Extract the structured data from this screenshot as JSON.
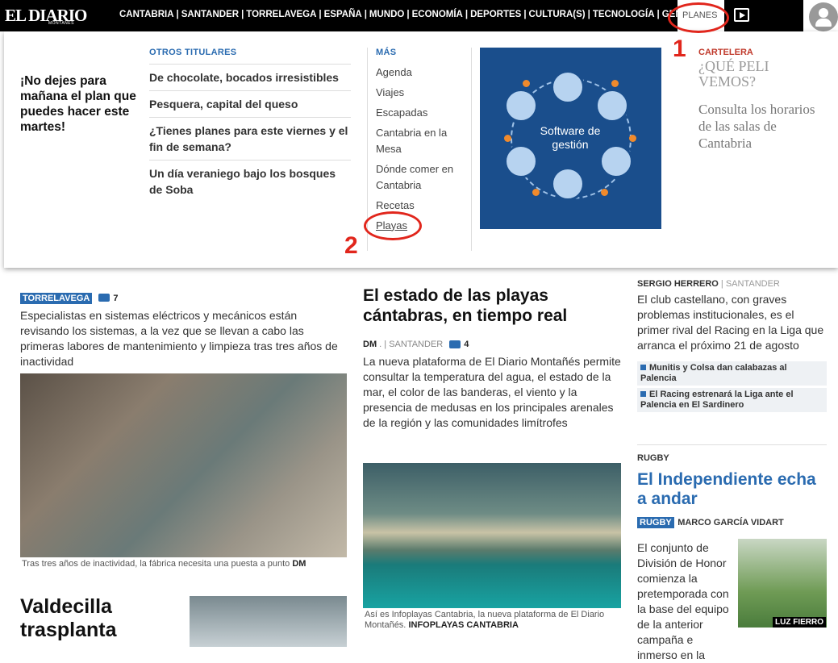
{
  "header": {
    "logo": "EL DIARIO",
    "logo_sub": "MONTAÑÉS",
    "nav": [
      "CANTABRIA",
      "SANTANDER",
      "TORRELAVEGA",
      "ESPAÑA",
      "MUNDO",
      "ECONOMÍA",
      "DEPORTES",
      "CULTURA(S)",
      "TECNOLOGÍA",
      "GENTE"
    ],
    "planes": "PLANES"
  },
  "dropdown": {
    "promo": "¡No dejes para mañana el plan que puedes hacer este martes!",
    "otros_title": "OTROS TITULARES",
    "otros": [
      "De chocolate, bocados irresistibles",
      "Pesquera, capital del queso",
      "¿Tienes planes para este viernes y el fin de semana?",
      "Un día veraniego bajo los bosques de Soba"
    ],
    "mas_title": "MÁS",
    "mas": [
      "Agenda",
      "Viajes",
      "Escapadas",
      "Cantabria en la Mesa",
      "Dónde comer en Cantabria",
      "Recetas",
      "Playas"
    ],
    "ad_text": "Software de gestión",
    "cartelera_label": "CARTELERA",
    "cartelera_q": "¿QUÉ PELI VEMOS?",
    "cartelera_desc": "Consulta los horarios de las salas de Cantabria"
  },
  "annotations": {
    "one": "1",
    "two": "2"
  },
  "colors": {
    "accent": "#2a6bb0",
    "annotation": "#e1261c"
  },
  "articles": {
    "a1": {
      "tag": "TORRELAVEGA",
      "comments": "7",
      "body": "Especialistas en sistemas eléctricos y mecánicos están revisando los sistemas, a la vez que se llevan a cabo las primeras labores de mantenimiento y limpieza tras tres años de inactividad",
      "caption": "Tras tres años de inactividad, la fábrica necesita una puesta a punto",
      "caption_credit": "DM"
    },
    "a1b": {
      "headline": "Valdecilla trasplanta"
    },
    "a2": {
      "headline": "El estado de las playas cántabras, en tiempo real",
      "author": "DM",
      "location": ". | SANTANDER",
      "comments": "4",
      "body": "La nueva plataforma de El Diario Montañés permite consultar la temperatura del agua, el estado de la mar, el color de las banderas, el viento y la presencia de medusas en los principales arenales de la región y las comunidades limítrofes",
      "caption": "Así es Infoplayas Cantabria, la nueva plataforma de El Diario Montañés.",
      "caption_credit": "INFOPLAYAS CANTABRIA"
    },
    "r1": {
      "author": "SERGIO HERRERO",
      "location": "| SANTANDER",
      "body": "El club castellano, con graves problemas institucionales, es el primer rival del Racing en la Liga que arranca el próximo 21 de agosto",
      "related": [
        "Munitis y Colsa dan calabazas al Palencia",
        "El Racing estrenará la Liga ante el Palencia en El Sardinero"
      ]
    },
    "r2": {
      "section": "RUGBY",
      "headline": "El Independiente echa a andar",
      "tag": "RUGBY",
      "author": "MARCO GARCÍA VIDART",
      "body": "El conjunto de División de Honor comienza la pretemporada con la base del equipo de la anterior campaña e inmerso en la",
      "photo_credit": "LUZ FIERRO"
    }
  }
}
